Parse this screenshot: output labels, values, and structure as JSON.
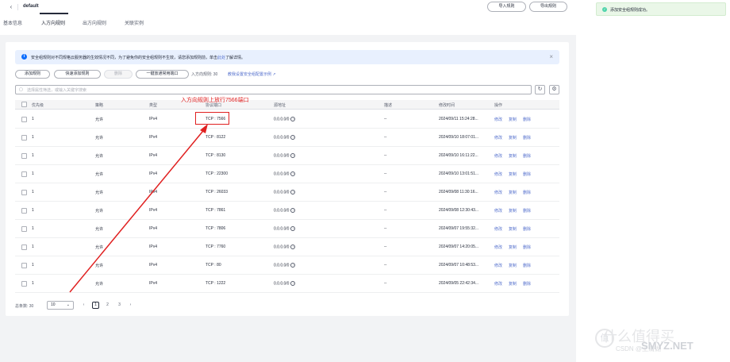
{
  "header": {
    "title": "default",
    "import_label": "导入规则",
    "export_label": "导出规则"
  },
  "tabs": [
    {
      "label": "基本信息",
      "active": false
    },
    {
      "label": "入方向规则",
      "active": true
    },
    {
      "label": "出方向规则",
      "active": false
    },
    {
      "label": "关联实例",
      "active": false
    }
  ],
  "notice": {
    "text": "安全组规则对不同规格云服务器的生效情况不同，为了避免你的安全组规则不生效，请您添加规则前，单击此处了解详情。",
    "link_text": "此处"
  },
  "toolbar": {
    "add_rule": "添加规则",
    "quick_add": "快速添加规则",
    "delete": "删除",
    "one_click": "一键放通常用端口",
    "rule_count": "入方向规则: 30",
    "example_link": "教我设置安全组配置示例 ↗"
  },
  "search": {
    "placeholder": "选择属性筛选，或输入关键字搜索"
  },
  "table": {
    "headers": [
      "优先级",
      "策略",
      "类型",
      "协议端口",
      "源地址",
      "描述",
      "修改时间",
      "操作"
    ],
    "ops": [
      "修改",
      "复制",
      "删除"
    ],
    "rows": [
      {
        "priority": "1",
        "policy": "允许",
        "type": "IPv4",
        "port": "TCP : 7566",
        "source": "0.0.0.0/0",
        "desc": "--",
        "time": "2024/09/11 15:24:28..."
      },
      {
        "priority": "1",
        "policy": "允许",
        "type": "IPv4",
        "port": "TCP : 8122",
        "source": "0.0.0.0/0",
        "desc": "--",
        "time": "2024/09/10 18:07:01..."
      },
      {
        "priority": "1",
        "policy": "允许",
        "type": "IPv4",
        "port": "TCP : 8130",
        "source": "0.0.0.0/0",
        "desc": "--",
        "time": "2024/09/10 16:11:22..."
      },
      {
        "priority": "1",
        "policy": "允许",
        "type": "IPv4",
        "port": "TCP : 22300",
        "source": "0.0.0.0/0",
        "desc": "--",
        "time": "2024/09/10 13:01:51..."
      },
      {
        "priority": "1",
        "policy": "允许",
        "type": "IPv4",
        "port": "TCP : 26033",
        "source": "0.0.0.0/0",
        "desc": "--",
        "time": "2024/09/08 11:30:16..."
      },
      {
        "priority": "1",
        "policy": "允许",
        "type": "IPv4",
        "port": "TCP : 7861",
        "source": "0.0.0.0/0",
        "desc": "--",
        "time": "2024/09/08 12:30:43..."
      },
      {
        "priority": "1",
        "policy": "允许",
        "type": "IPv4",
        "port": "TCP : 7806",
        "source": "0.0.0.0/0",
        "desc": "--",
        "time": "2024/09/07 19:55:32..."
      },
      {
        "priority": "1",
        "policy": "允许",
        "type": "IPv4",
        "port": "TCP : 7760",
        "source": "0.0.0.0/0",
        "desc": "--",
        "time": "2024/09/07 14:20:05..."
      },
      {
        "priority": "1",
        "policy": "允许",
        "type": "IPv4",
        "port": "TCP : 80",
        "source": "0.0.0.0/0",
        "desc": "--",
        "time": "2024/09/07 10:48:53..."
      },
      {
        "priority": "1",
        "policy": "允许",
        "type": "IPv4",
        "port": "TCP : 1222",
        "source": "0.0.0.0/0",
        "desc": "--",
        "time": "2024/09/05 22:42:34..."
      }
    ]
  },
  "pager": {
    "total": "总条数: 30",
    "size": "10",
    "prev": "‹",
    "pages": [
      "1",
      "2",
      "3"
    ],
    "next": "›"
  },
  "toast": {
    "text": "添加安全组规则成功。"
  },
  "annotation": {
    "text": "入方向规则上放行7566端口"
  },
  "watermark": {
    "main": "SMYZ.NET",
    "sub": "什么值得买",
    "csdn": "CSDN @王清湖"
  },
  "colors": {
    "accent": "#526ecc",
    "annotation": "#e02020",
    "success": "#50d4ab",
    "notice_bg": "#e8f0fe"
  }
}
